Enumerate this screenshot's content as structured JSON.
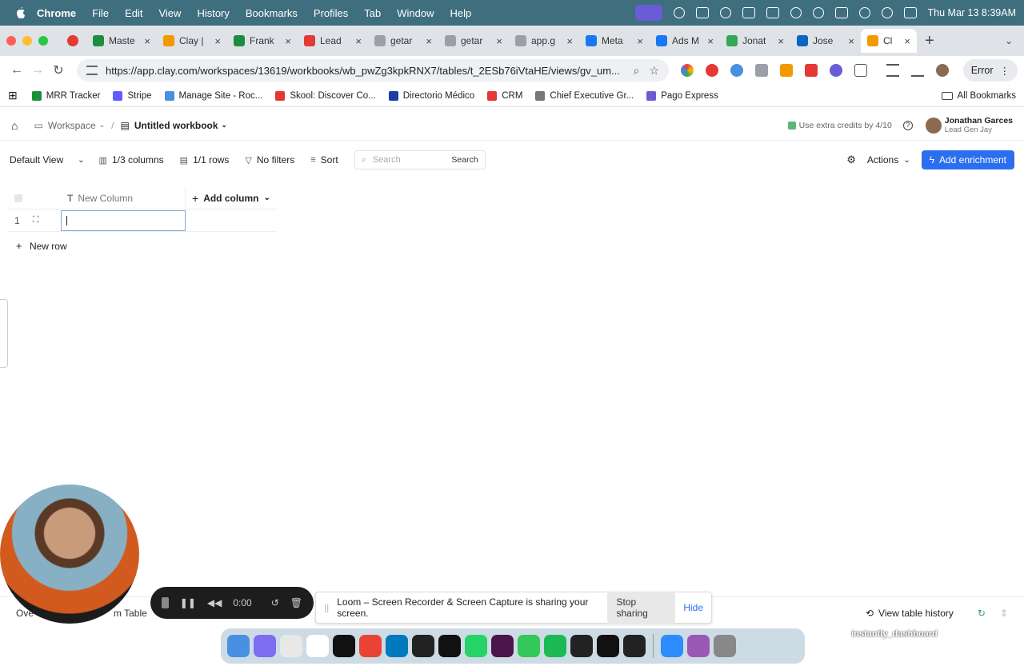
{
  "menubar": {
    "app": "Chrome",
    "items": [
      "File",
      "Edit",
      "View",
      "History",
      "Bookmarks",
      "Profiles",
      "Tab",
      "Window",
      "Help"
    ],
    "clock": "Thu Mar 13  8:39AM"
  },
  "tabs": [
    {
      "title": "Maste",
      "color": "#1e8e3e"
    },
    {
      "title": "Clay |",
      "color": "#f29900"
    },
    {
      "title": "Frank",
      "color": "#1e8e3e"
    },
    {
      "title": "Lead",
      "color": "#e53935"
    },
    {
      "title": "getar",
      "color": "#9aa0a6"
    },
    {
      "title": "getar",
      "color": "#9aa0a6"
    },
    {
      "title": "app.g",
      "color": "#9aa0a6"
    },
    {
      "title": "Meta",
      "color": "#1877f2"
    },
    {
      "title": "Ads M",
      "color": "#1877f2"
    },
    {
      "title": "Jonat",
      "color": "#34a853"
    },
    {
      "title": "Jose",
      "color": "#0a66c2"
    },
    {
      "title": "Cl",
      "color": "#f29900"
    }
  ],
  "address": {
    "url": "https://app.clay.com/workspaces/13619/workbooks/wb_pwZg3kpkRNX7/tables/t_2ESb76iVtaHE/views/gv_um...",
    "error_label": "Error"
  },
  "bookmarks": [
    {
      "label": "MRR Tracker",
      "color": "#1e8e3e"
    },
    {
      "label": "Stripe",
      "color": "#635bff"
    },
    {
      "label": "Manage Site - Roc...",
      "color": "#4a90e2"
    },
    {
      "label": "Skool: Discover Co...",
      "color": "#e53935"
    },
    {
      "label": "Directorio Médico",
      "color": "#1a3fa0"
    },
    {
      "label": "CRM",
      "color": "#e53935"
    },
    {
      "label": "Chief Executive Gr...",
      "color": "#777777"
    },
    {
      "label": "Pago Express",
      "color": "#6a5cd6"
    }
  ],
  "all_bookmarks": "All Bookmarks",
  "header": {
    "workspace": "Workspace",
    "workbook": "Untitled workbook",
    "credits": "Use extra credits by 4/10",
    "user_name": "Jonathan Garces",
    "user_sub": "Lead Gen Jay"
  },
  "toolbar": {
    "view": "Default View",
    "columns": "1/3 columns",
    "rows": "1/1 rows",
    "filters": "No filters",
    "sort": "Sort",
    "search_placeholder": "Search",
    "search_btn": "Search",
    "actions": "Actions",
    "enrich": "Add enrichment"
  },
  "grid": {
    "column": "New Column",
    "add_column": "Add column",
    "row_number": "1",
    "new_row": "New row"
  },
  "bottom": {
    "tab_a": "Ove",
    "tab_b": "m Table",
    "history": "View table history"
  },
  "loom": {
    "time": "0:00",
    "message": "Loom – Screen Recorder & Screen Capture is sharing your screen.",
    "stop": "Stop sharing",
    "hide": "Hide"
  },
  "dock": {
    "apps": [
      "#4a90e2",
      "#7d6df0",
      "#e8e8e8",
      "#ffffff",
      "#111111",
      "#ea4335",
      "#0079bf",
      "#222222",
      "#111111",
      "#25d366",
      "#4a154b",
      "#34c759",
      "#1db954",
      "#222222",
      "#111111",
      "#222222",
      "#2d8cff",
      "#9b59b6",
      "#888888"
    ],
    "label": "instantly_dashboard"
  }
}
